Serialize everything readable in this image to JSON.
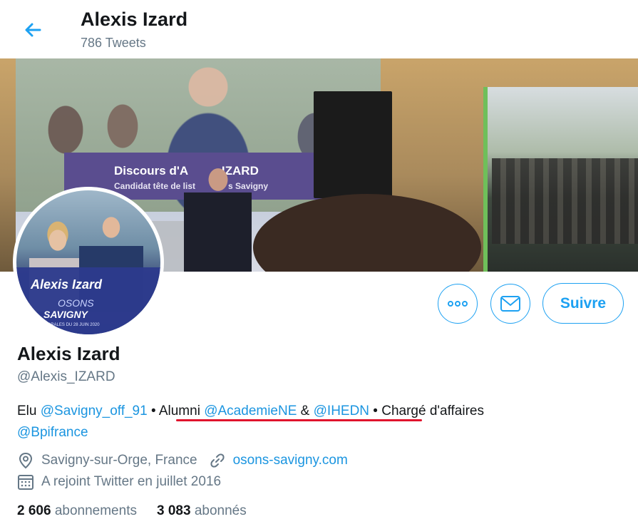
{
  "header": {
    "title": "Alexis Izard",
    "tweet_count": "786 Tweets"
  },
  "banner": {
    "screen_line1": "Discours d'A",
    "screen_line1b": " IZARD",
    "screen_line2": "Candidat tête de list",
    "screen_line2b": "s Savigny"
  },
  "avatar": {
    "name": "Alexis Izard",
    "osons": "OSONS",
    "savigny": "SAVIGNY",
    "small": "TORALES DU 28 JUIN 2020"
  },
  "actions": {
    "follow_label": "Suivre"
  },
  "profile": {
    "name": "Alexis Izard",
    "handle": "@Alexis_IZARD",
    "bio": {
      "t1": "Elu ",
      "m1": "@Savigny_off_91",
      "t2": " • Alumni ",
      "m2": "@AcademieNE",
      "t3": " & ",
      "m3": "@IHEDN",
      "t4": " • Chargé d'affaires ",
      "m4": "@Bpifrance"
    },
    "location": "Savigny-sur-Orge, France",
    "website": "osons-savigny.com",
    "joined": "A rejoint Twitter en juillet 2016"
  },
  "stats": {
    "following_count": "2 606",
    "following_label": "abonnements",
    "followers_count": "3 083",
    "followers_label": "abonnés"
  },
  "colors": {
    "accent": "#1da1f2",
    "link": "#1b95e0",
    "muted": "#657786",
    "underline": "#e0142d"
  }
}
